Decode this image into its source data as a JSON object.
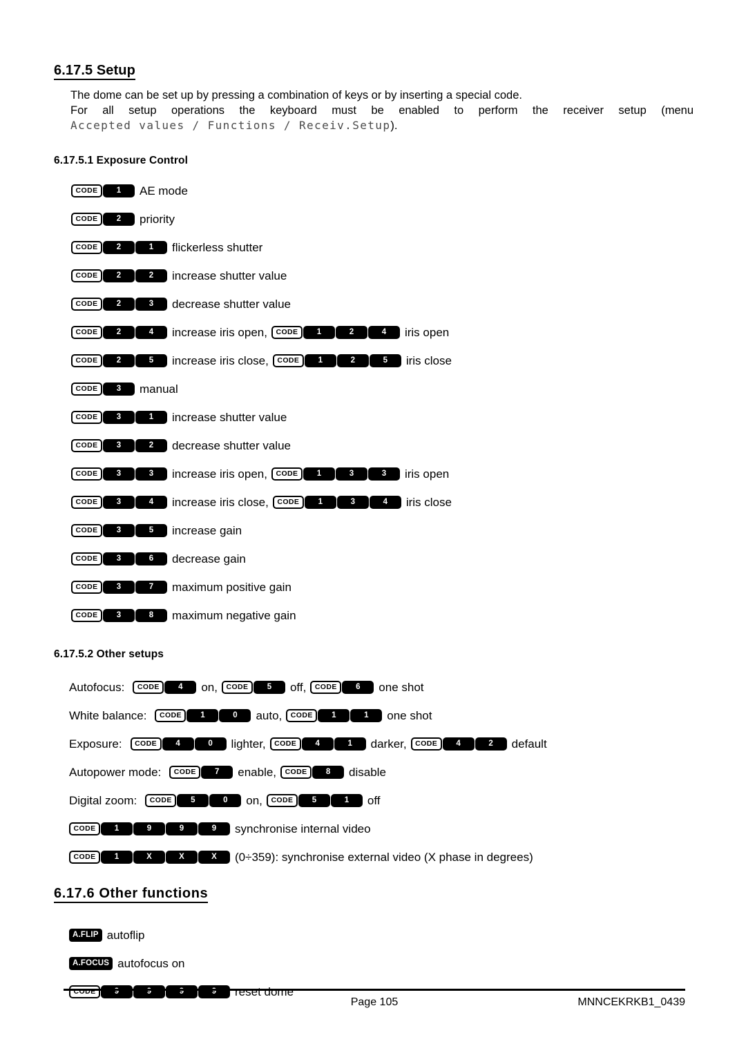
{
  "document": {
    "sections": [
      {
        "id": "setup",
        "number": "6.17.5",
        "title": "6.17.5 Setup",
        "intro": {
          "line1": "The dome can be set up by pressing a combination of keys or by inserting a special code.",
          "line2": "For all setup operations the keyboard must be enabled to perform the receiver setup (menu",
          "line3_mono": "Accepted values / Functions / Receiv.Setup",
          "line3_tail": ")."
        }
      }
    ],
    "subsections": [
      {
        "id": "exposure-control",
        "title": "6.17.5.1 Exposure Control"
      },
      {
        "id": "other-setups",
        "title": "6.17.5.2 Other setups"
      }
    ],
    "other_functions": {
      "title": "6.17.6 Other functions"
    }
  },
  "keys": {
    "code_label": "CODE",
    "aflip_label": "A.FLIP",
    "afocus_label": "A.FOCUS"
  },
  "exposure_control_rows": [
    {
      "keys": [
        "1"
      ],
      "label": "AE mode"
    },
    {
      "keys": [
        "2"
      ],
      "label": "priority"
    },
    {
      "keys": [
        "2",
        "1"
      ],
      "label": "flickerless shutter"
    },
    {
      "keys": [
        "2",
        "2"
      ],
      "label": "increase shutter value"
    },
    {
      "keys": [
        "2",
        "3"
      ],
      "label": "decrease shutter value"
    },
    {
      "keys": [
        "2",
        "4"
      ],
      "label": "increase iris open,",
      "keys2": [
        "1",
        "2",
        "4"
      ],
      "label2": "iris open"
    },
    {
      "keys": [
        "2",
        "5"
      ],
      "label": "increase iris close,",
      "keys2": [
        "1",
        "2",
        "5"
      ],
      "label2": "iris close"
    },
    {
      "keys": [
        "3"
      ],
      "label": "manual"
    },
    {
      "keys": [
        "3",
        "1"
      ],
      "label": "increase shutter value"
    },
    {
      "keys": [
        "3",
        "2"
      ],
      "label": "decrease shutter value"
    },
    {
      "keys": [
        "3",
        "3"
      ],
      "label": "increase iris open,",
      "keys2": [
        "1",
        "3",
        "3"
      ],
      "label2": "iris open"
    },
    {
      "keys": [
        "3",
        "4"
      ],
      "label": "increase iris close,",
      "keys2": [
        "1",
        "3",
        "4"
      ],
      "label2": "iris close"
    },
    {
      "keys": [
        "3",
        "5"
      ],
      "label": "increase gain"
    },
    {
      "keys": [
        "3",
        "6"
      ],
      "label": "decrease gain"
    },
    {
      "keys": [
        "3",
        "7"
      ],
      "label": "maximum positive gain"
    },
    {
      "keys": [
        "3",
        "8"
      ],
      "label": "maximum negative gain"
    }
  ],
  "other_setups_rows": [
    {
      "prefix": "Autofocus:",
      "groups": [
        {
          "keys": [
            "4"
          ],
          "after": "on,"
        },
        {
          "keys": [
            "5"
          ],
          "after": "off,"
        },
        {
          "keys": [
            "6"
          ],
          "after": "one shot"
        }
      ]
    },
    {
      "prefix": "White balance:",
      "groups": [
        {
          "keys": [
            "1",
            "0"
          ],
          "after": "auto,"
        },
        {
          "keys": [
            "1",
            "1"
          ],
          "after": "one shot"
        }
      ]
    },
    {
      "prefix": "Exposure:",
      "groups": [
        {
          "keys": [
            "4",
            "0"
          ],
          "after": "lighter,"
        },
        {
          "keys": [
            "4",
            "1"
          ],
          "after": "darker,"
        },
        {
          "keys": [
            "4",
            "2"
          ],
          "after": "default"
        }
      ]
    },
    {
      "prefix": "Autopower mode:",
      "groups": [
        {
          "keys": [
            "7"
          ],
          "after": "enable,"
        },
        {
          "keys": [
            "8"
          ],
          "after": "disable"
        }
      ]
    },
    {
      "prefix": "Digital zoom:",
      "groups": [
        {
          "keys": [
            "5",
            "0"
          ],
          "after": "on,"
        },
        {
          "keys": [
            "5",
            "1"
          ],
          "after": "off"
        }
      ]
    },
    {
      "prefix": "",
      "groups": [
        {
          "keys": [
            "1",
            "9",
            "9",
            "9"
          ],
          "after": "synchronise internal video"
        }
      ]
    },
    {
      "prefix": "",
      "groups": [
        {
          "keys": [
            "1",
            "X",
            "X",
            "X"
          ],
          "after": "(0÷359): synchronise external video (X phase in degrees)"
        }
      ]
    }
  ],
  "other_functions_rows": [
    {
      "fn_key": "A.FLIP",
      "label": "autoflip"
    },
    {
      "fn_key": "A.FOCUS",
      "label": "autofocus on"
    },
    {
      "code": true,
      "keys": [
        "9",
        "9",
        "9",
        "9"
      ],
      "label": "reset dome"
    }
  ],
  "footer": {
    "page": "Page 105",
    "doc_code": "MNNCEKRKB1_0439"
  }
}
